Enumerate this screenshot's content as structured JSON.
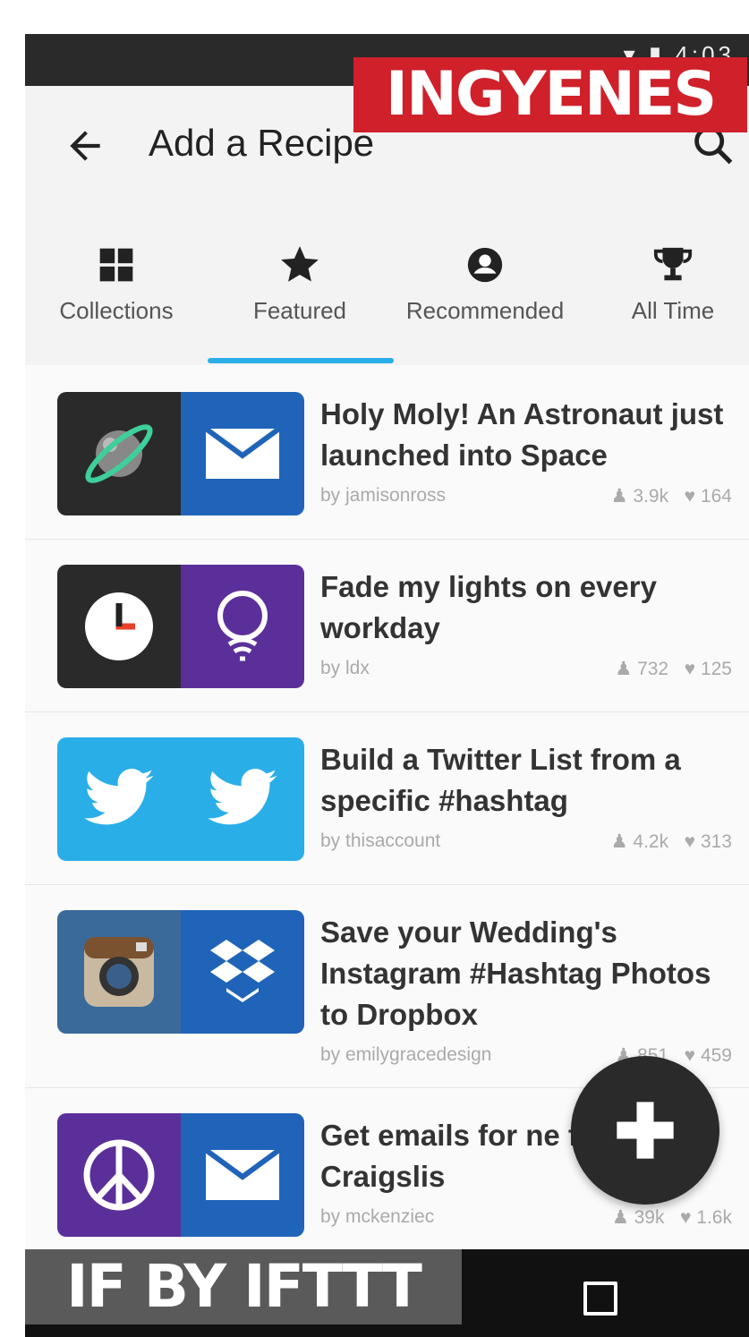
{
  "status": {
    "time": "4:03"
  },
  "appbar": {
    "title": "Add a Recipe"
  },
  "banners": {
    "top": "INGYENES",
    "bottom": "IF BY IFTTT"
  },
  "tabs": [
    {
      "label": "Collections",
      "icon": "grid-icon"
    },
    {
      "label": "Featured",
      "icon": "star-icon",
      "active": true
    },
    {
      "label": "Recommended",
      "icon": "user-circle-icon"
    },
    {
      "label": "All Time",
      "icon": "trophy-icon"
    }
  ],
  "recipes": [
    {
      "title": "Holy Moly! An Astronaut just launched into Space",
      "author": "by jamisonross",
      "uses": "3.9k",
      "likes": "164",
      "left_icon": "planet-icon",
      "right_icon": "email-icon",
      "left_bg": "#2a2a2a",
      "right_bg": "#1f64b8"
    },
    {
      "title": "Fade my lights on every workday",
      "author": "by ldx",
      "uses": "732",
      "likes": "125",
      "left_icon": "clock-icon",
      "right_icon": "lightbulb-icon",
      "left_bg": "#2a2a2a",
      "right_bg": "#5b2f9a"
    },
    {
      "title": "Build a Twitter List from a specific #hashtag",
      "author": "by thisaccount",
      "uses": "4.2k",
      "likes": "313",
      "left_icon": "twitter-icon",
      "right_icon": "twitter-icon",
      "left_bg": "#2aaee8",
      "right_bg": "#2aaee8"
    },
    {
      "title": "Save your Wedding's Instagram #Hashtag Photos to Dropbox",
      "author": "by emilygracedesign",
      "uses": "851",
      "likes": "459",
      "left_icon": "instagram-icon",
      "right_icon": "dropbox-icon",
      "left_bg": "#3a6a9a",
      "right_bg": "#1f64b8"
    },
    {
      "title": "Get emails for ne from any Craigslis",
      "author": "by mckenziec",
      "uses": "39k",
      "likes": "1.6k",
      "left_icon": "peace-icon",
      "right_icon": "email-icon",
      "left_bg": "#5b2f9a",
      "right_bg": "#1f64b8"
    }
  ]
}
